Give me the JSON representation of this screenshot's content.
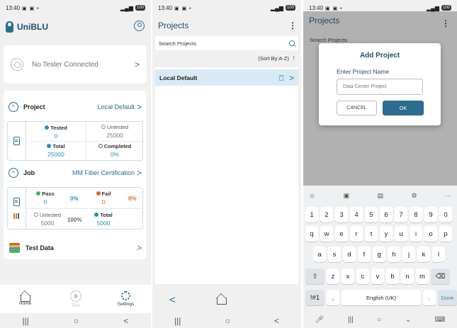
{
  "status": {
    "time": "13:40",
    "battery": "100",
    "icons_left": "▣ ▣ •"
  },
  "nav": {
    "recents": "|||",
    "home": "○",
    "back": "<"
  },
  "screen1": {
    "app_title": "UniBLU",
    "tester": {
      "text": "No Tester Connected"
    },
    "project": {
      "label": "Project",
      "value": "Local Default",
      "tested_label": "Tested",
      "tested_value": "0",
      "untested_label": "Untested",
      "untested_value": "25000",
      "total_label": "Total",
      "total_value": "25000",
      "completed_label": "Completed",
      "completed_value": "0%"
    },
    "job": {
      "label": "Job",
      "value": "MM Fiber Certification",
      "pass_label": "Pass",
      "pass_value": "0",
      "pass_pct": "0%",
      "fail_label": "Fail",
      "fail_value": "0",
      "fail_pct": "0%",
      "untested_label": "Untested",
      "untested_value": "5000",
      "untested_pct": "100%",
      "total_label": "Total",
      "total_value": "5000"
    },
    "test_data": {
      "label": "Test Data"
    },
    "bottom_nav": {
      "home": "Home",
      "test": "Test",
      "settings": "Settings"
    }
  },
  "screen2": {
    "title": "Projects",
    "search_placeholder": "Search Projects",
    "sort_label": "(Sort By:A-Z)",
    "projects": [
      {
        "name": "Local Default"
      }
    ]
  },
  "screen3": {
    "title": "Projects",
    "search_placeholder": "Search Projects",
    "dialog": {
      "title": "Add Project",
      "label": "Enter Project Name",
      "input_placeholder": "Data Center Project",
      "cancel": "CANCEL",
      "ok": "OK"
    },
    "keyboard": {
      "numbers": [
        "1",
        "2",
        "3",
        "4",
        "5",
        "6",
        "7",
        "8",
        "9",
        "0"
      ],
      "row1": [
        "q",
        "w",
        "e",
        "r",
        "t",
        "y",
        "u",
        "i",
        "o",
        "p"
      ],
      "row2": [
        "a",
        "s",
        "d",
        "f",
        "g",
        "h",
        "j",
        "k",
        "l"
      ],
      "row3": [
        "z",
        "x",
        "c",
        "v",
        "b",
        "n",
        "m"
      ],
      "symbols_key": "!#1",
      "comma_key": ",",
      "space_label": "English (UK)",
      "period_key": ".",
      "done_key": "Done"
    }
  }
}
